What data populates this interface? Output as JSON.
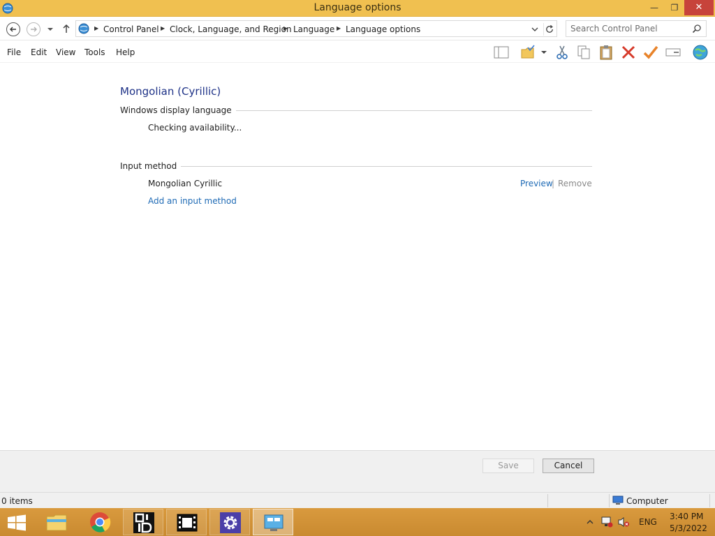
{
  "window": {
    "title": "Language options"
  },
  "address": {
    "breadcrumbs": [
      "Control Panel",
      "Clock, Language, and Region",
      "Language",
      "Language options"
    ],
    "search_placeholder": "Search Control Panel"
  },
  "menu": {
    "items": [
      "File",
      "Edit",
      "View",
      "Tools",
      "Help"
    ]
  },
  "content": {
    "language_name": "Mongolian (Cyrillic)",
    "display_language": {
      "label": "Windows display language",
      "status": "Checking availability..."
    },
    "input_method": {
      "label": "Input method",
      "method_name": "Mongolian Cyrillic",
      "preview_link": "Preview",
      "separator": "|",
      "remove_link": "Remove",
      "add_link": "Add an input method"
    }
  },
  "buttons": {
    "save": "Save",
    "cancel": "Cancel"
  },
  "status": {
    "items": "0 items",
    "location": "Computer"
  },
  "taskbar": {
    "language": "ENG",
    "time": "3:40 PM",
    "date": "5/3/2022"
  },
  "colors": {
    "titlebar": "#f0c050",
    "heading": "#1e3287",
    "link": "#1e6ab5",
    "close_button": "#c7433b",
    "taskbar": "#d99a3e"
  }
}
